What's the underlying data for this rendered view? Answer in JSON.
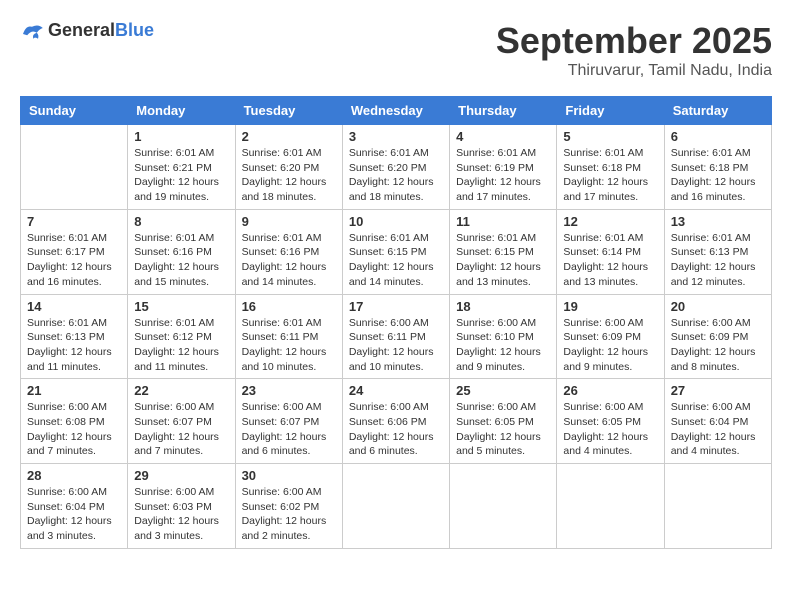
{
  "header": {
    "logo_general": "General",
    "logo_blue": "Blue",
    "month_title": "September 2025",
    "location": "Thiruvarur, Tamil Nadu, India"
  },
  "days_of_week": [
    "Sunday",
    "Monday",
    "Tuesday",
    "Wednesday",
    "Thursday",
    "Friday",
    "Saturday"
  ],
  "weeks": [
    [
      {
        "day": "",
        "info": ""
      },
      {
        "day": "1",
        "info": "Sunrise: 6:01 AM\nSunset: 6:21 PM\nDaylight: 12 hours\nand 19 minutes."
      },
      {
        "day": "2",
        "info": "Sunrise: 6:01 AM\nSunset: 6:20 PM\nDaylight: 12 hours\nand 18 minutes."
      },
      {
        "day": "3",
        "info": "Sunrise: 6:01 AM\nSunset: 6:20 PM\nDaylight: 12 hours\nand 18 minutes."
      },
      {
        "day": "4",
        "info": "Sunrise: 6:01 AM\nSunset: 6:19 PM\nDaylight: 12 hours\nand 17 minutes."
      },
      {
        "day": "5",
        "info": "Sunrise: 6:01 AM\nSunset: 6:18 PM\nDaylight: 12 hours\nand 17 minutes."
      },
      {
        "day": "6",
        "info": "Sunrise: 6:01 AM\nSunset: 6:18 PM\nDaylight: 12 hours\nand 16 minutes."
      }
    ],
    [
      {
        "day": "7",
        "info": "Sunrise: 6:01 AM\nSunset: 6:17 PM\nDaylight: 12 hours\nand 16 minutes."
      },
      {
        "day": "8",
        "info": "Sunrise: 6:01 AM\nSunset: 6:16 PM\nDaylight: 12 hours\nand 15 minutes."
      },
      {
        "day": "9",
        "info": "Sunrise: 6:01 AM\nSunset: 6:16 PM\nDaylight: 12 hours\nand 14 minutes."
      },
      {
        "day": "10",
        "info": "Sunrise: 6:01 AM\nSunset: 6:15 PM\nDaylight: 12 hours\nand 14 minutes."
      },
      {
        "day": "11",
        "info": "Sunrise: 6:01 AM\nSunset: 6:15 PM\nDaylight: 12 hours\nand 13 minutes."
      },
      {
        "day": "12",
        "info": "Sunrise: 6:01 AM\nSunset: 6:14 PM\nDaylight: 12 hours\nand 13 minutes."
      },
      {
        "day": "13",
        "info": "Sunrise: 6:01 AM\nSunset: 6:13 PM\nDaylight: 12 hours\nand 12 minutes."
      }
    ],
    [
      {
        "day": "14",
        "info": "Sunrise: 6:01 AM\nSunset: 6:13 PM\nDaylight: 12 hours\nand 11 minutes."
      },
      {
        "day": "15",
        "info": "Sunrise: 6:01 AM\nSunset: 6:12 PM\nDaylight: 12 hours\nand 11 minutes."
      },
      {
        "day": "16",
        "info": "Sunrise: 6:01 AM\nSunset: 6:11 PM\nDaylight: 12 hours\nand 10 minutes."
      },
      {
        "day": "17",
        "info": "Sunrise: 6:00 AM\nSunset: 6:11 PM\nDaylight: 12 hours\nand 10 minutes."
      },
      {
        "day": "18",
        "info": "Sunrise: 6:00 AM\nSunset: 6:10 PM\nDaylight: 12 hours\nand 9 minutes."
      },
      {
        "day": "19",
        "info": "Sunrise: 6:00 AM\nSunset: 6:09 PM\nDaylight: 12 hours\nand 9 minutes."
      },
      {
        "day": "20",
        "info": "Sunrise: 6:00 AM\nSunset: 6:09 PM\nDaylight: 12 hours\nand 8 minutes."
      }
    ],
    [
      {
        "day": "21",
        "info": "Sunrise: 6:00 AM\nSunset: 6:08 PM\nDaylight: 12 hours\nand 7 minutes."
      },
      {
        "day": "22",
        "info": "Sunrise: 6:00 AM\nSunset: 6:07 PM\nDaylight: 12 hours\nand 7 minutes."
      },
      {
        "day": "23",
        "info": "Sunrise: 6:00 AM\nSunset: 6:07 PM\nDaylight: 12 hours\nand 6 minutes."
      },
      {
        "day": "24",
        "info": "Sunrise: 6:00 AM\nSunset: 6:06 PM\nDaylight: 12 hours\nand 6 minutes."
      },
      {
        "day": "25",
        "info": "Sunrise: 6:00 AM\nSunset: 6:05 PM\nDaylight: 12 hours\nand 5 minutes."
      },
      {
        "day": "26",
        "info": "Sunrise: 6:00 AM\nSunset: 6:05 PM\nDaylight: 12 hours\nand 4 minutes."
      },
      {
        "day": "27",
        "info": "Sunrise: 6:00 AM\nSunset: 6:04 PM\nDaylight: 12 hours\nand 4 minutes."
      }
    ],
    [
      {
        "day": "28",
        "info": "Sunrise: 6:00 AM\nSunset: 6:04 PM\nDaylight: 12 hours\nand 3 minutes."
      },
      {
        "day": "29",
        "info": "Sunrise: 6:00 AM\nSunset: 6:03 PM\nDaylight: 12 hours\nand 3 minutes."
      },
      {
        "day": "30",
        "info": "Sunrise: 6:00 AM\nSunset: 6:02 PM\nDaylight: 12 hours\nand 2 minutes."
      },
      {
        "day": "",
        "info": ""
      },
      {
        "day": "",
        "info": ""
      },
      {
        "day": "",
        "info": ""
      },
      {
        "day": "",
        "info": ""
      }
    ]
  ]
}
